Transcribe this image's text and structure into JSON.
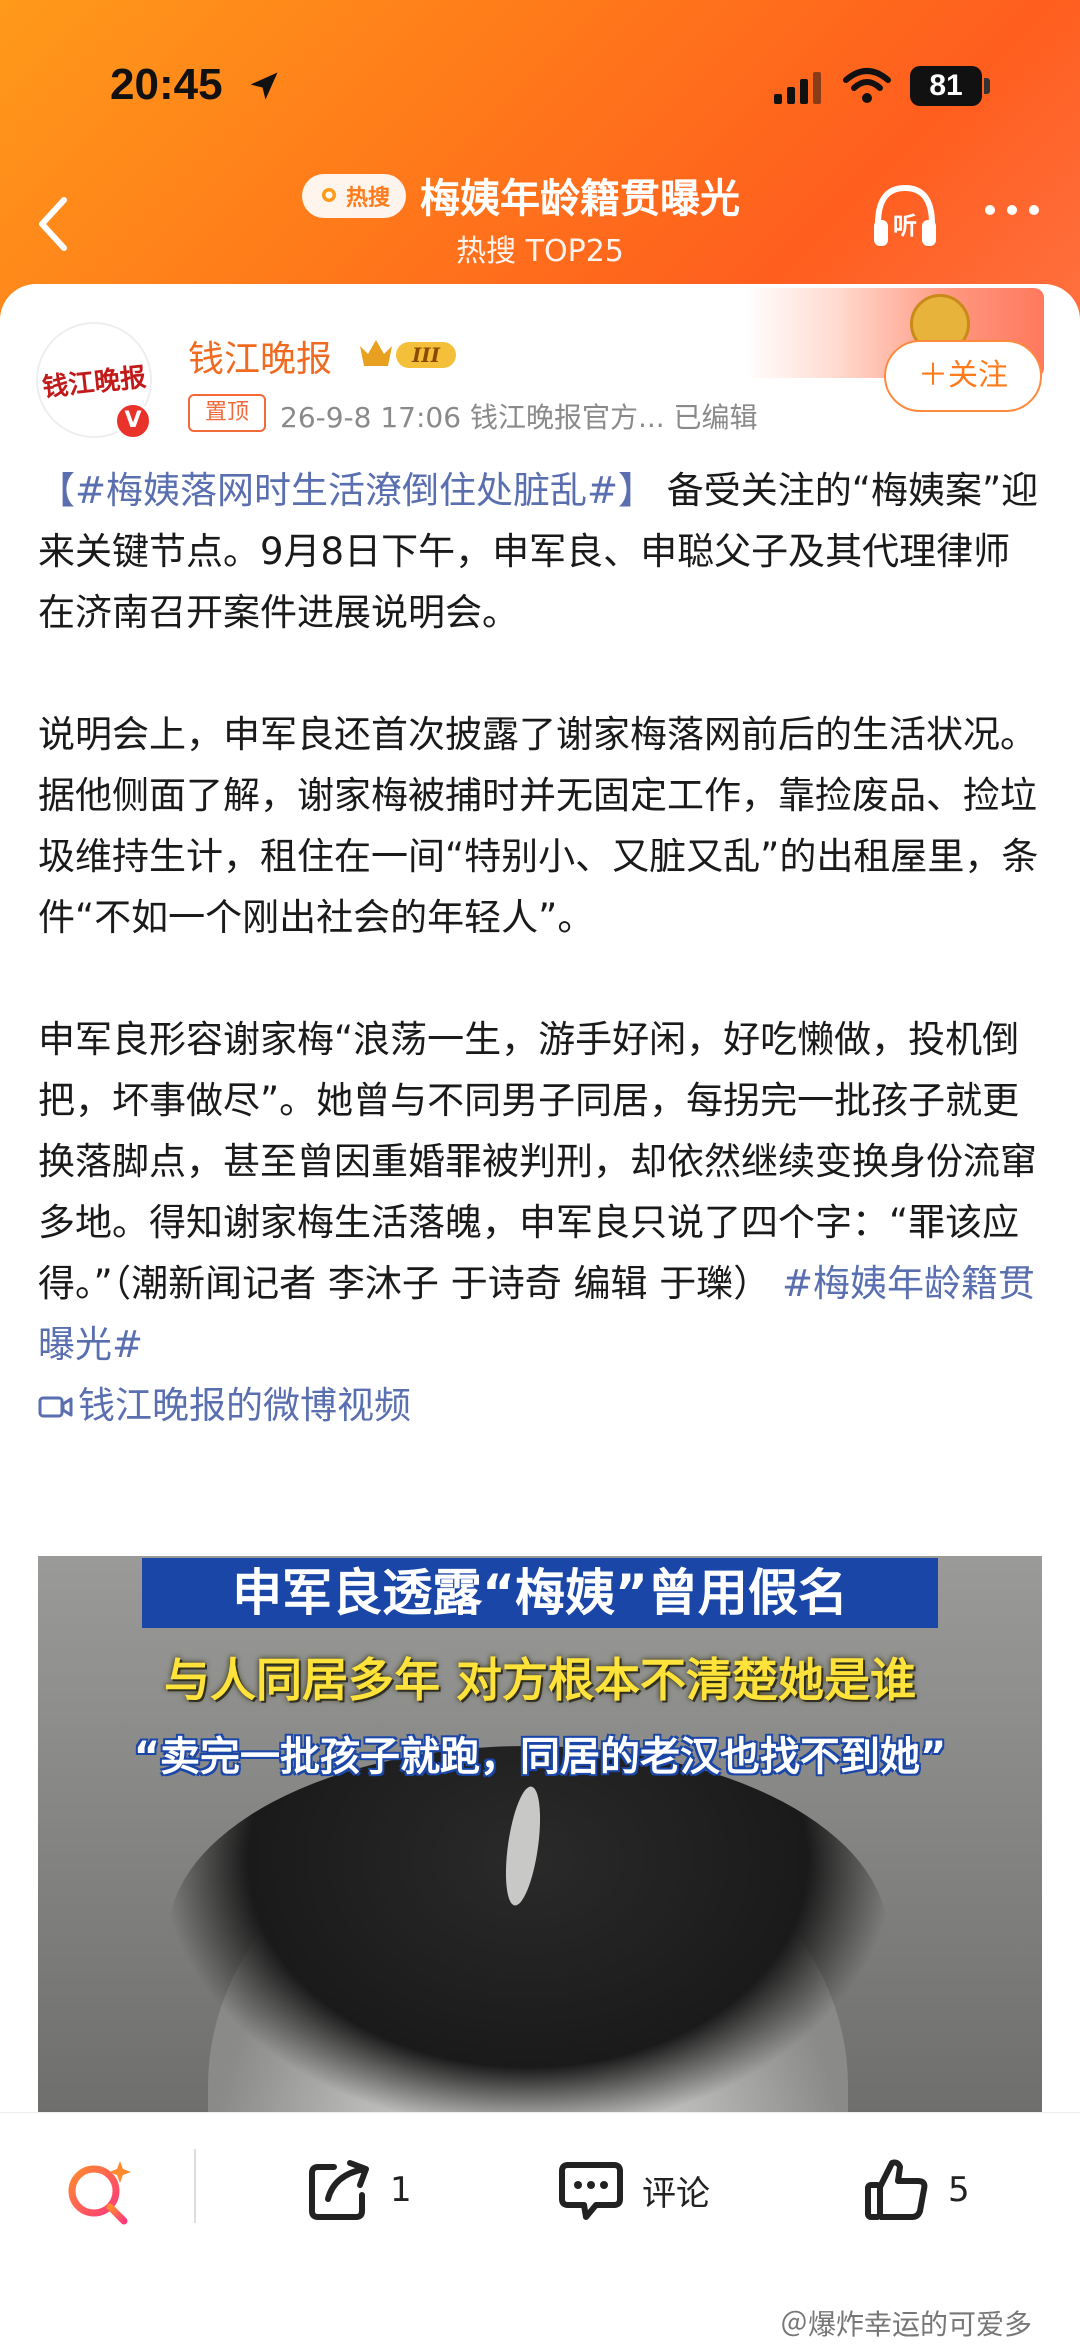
{
  "status_bar": {
    "time": "20:45",
    "battery": "81"
  },
  "nav": {
    "hot_pill_label": "热搜",
    "title": "梅姨年龄籍贯曝光",
    "subtitle": "热搜 TOP25",
    "listen_label": "听"
  },
  "post": {
    "avatar_text": "钱江晚报",
    "verified_mark": "V",
    "author": "钱江晚报",
    "level_badge": "III",
    "pin_tag": "置顶",
    "meta": "26-9-8 17:06   钱江晚报官方...   已编辑",
    "follow_label": "＋关注",
    "paragraphs": [
      {
        "hashtag_open": "【#梅姨落网时生活潦倒住处脏乱#】",
        "text": "备受关注的“梅姨案”迎来关键节点。9月8日下午，申军良、申聪父子及其代理律师在济南召开案件进展说明会。"
      },
      {
        "text": "说明会上，申军良还首次披露了谢家梅落网前后的生活状况。据他侧面了解，谢家梅被捕时并无固定工作，靠捡废品、捡垃圾维持生计，租住在一间“特别小、又脏又乱”的出租屋里，条件“不如一个刚出社会的年轻人”。"
      },
      {
        "text": "申军良形容谢家梅“浪荡一生，游手好闲，好吃懒做，投机倒把，坏事做尽”。她曾与不同男子同居，每拐完一批孩子就更换落脚点，甚至曾因重婚罪被判刑，却依然继续变换身份流窜多地。得知谢家梅生活落魄，申军良只说了四个字：“罪该应得。”（潮新闻记者 李沐子 于诗奇 编辑 于瓅）",
        "hashtag_close": "#梅姨年龄籍贯曝光#"
      }
    ],
    "video_link": "钱江晚报的微博视频"
  },
  "video": {
    "title_line1": "申军良透露“梅姨”曾用假名",
    "title_line2": "与人同居多年 对方根本不清楚她是谁",
    "title_line3": "“卖完一批孩子就跑，同居的老汉也找不到她”"
  },
  "bottom_bar": {
    "share_count": "1",
    "comment_label": "评论",
    "like_count": "5",
    "watermark": "＠爆炸幸运的可爱多"
  },
  "colors": {
    "brand_orange": "#ff7a1a",
    "hashtag_blue": "#5a6fb0",
    "author_orange": "#f06a20"
  }
}
